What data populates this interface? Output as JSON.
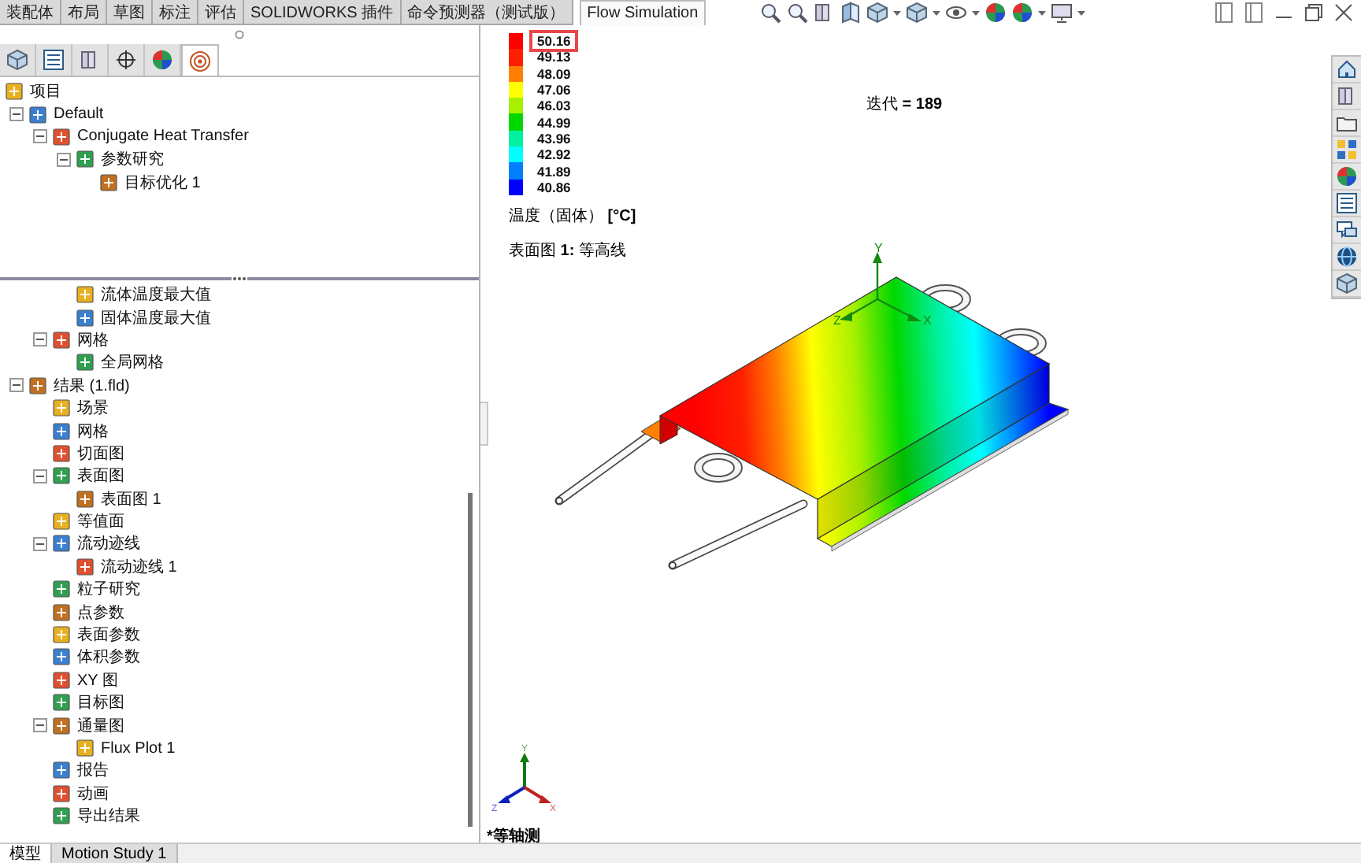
{
  "command_tabs": [
    {
      "label": "装配体",
      "selected": false
    },
    {
      "label": "布局",
      "selected": false
    },
    {
      "label": "草图",
      "selected": false
    },
    {
      "label": "标注",
      "selected": false
    },
    {
      "label": "评估",
      "selected": false
    },
    {
      "label": "SOLIDWORKS 插件",
      "selected": false
    },
    {
      "label": "命令预测器（测试版）",
      "selected": false
    },
    {
      "label": "Flow Simulation",
      "selected": true
    }
  ],
  "panel_tabs": [
    {
      "selected": false
    },
    {
      "selected": false
    },
    {
      "selected": false
    },
    {
      "selected": false
    },
    {
      "selected": false
    },
    {
      "selected": true
    }
  ],
  "upper_tree": [
    {
      "label": "项目",
      "children": [
        {
          "label": "Default",
          "expanded": true,
          "children": [
            {
              "label": "Conjugate Heat Transfer",
              "expanded": true,
              "children": [
                {
                  "label": "参数研究",
                  "expanded": true,
                  "children": [
                    {
                      "label": "目标优化 1"
                    }
                  ]
                }
              ]
            }
          ]
        }
      ]
    }
  ],
  "lower_tree": [
    {
      "children": [
        {
          "children": [
            {
              "children": [
                {
                  "label": "流体温度最大值"
                },
                {
                  "label": "固体温度最大值"
                }
              ]
            },
            {
              "label": "网格",
              "expanded": true,
              "children": [
                {
                  "label": "全局网格"
                }
              ]
            }
          ]
        },
        {
          "label": "结果 (1.fld)",
          "expanded": true,
          "children": [
            {
              "label": "场景"
            },
            {
              "label": "网格"
            },
            {
              "label": "切面图"
            },
            {
              "label": "表面图",
              "expanded": true,
              "children": [
                {
                  "label": "表面图 1"
                }
              ]
            },
            {
              "label": "等值面"
            },
            {
              "label": "流动迹线",
              "expanded": true,
              "children": [
                {
                  "label": "流动迹线 1"
                }
              ]
            },
            {
              "label": "粒子研究"
            },
            {
              "label": "点参数"
            },
            {
              "label": "表面参数"
            },
            {
              "label": "体积参数"
            },
            {
              "label": "XY 图"
            },
            {
              "label": "目标图"
            },
            {
              "label": "通量图",
              "expanded": true,
              "children": [
                {
                  "label": "Flux Plot 1"
                }
              ]
            },
            {
              "label": "报告"
            },
            {
              "label": "动画"
            },
            {
              "label": "导出结果"
            }
          ]
        }
      ]
    }
  ],
  "legend": {
    "entries": [
      {
        "value": "50.16",
        "color": "#ff0000",
        "highlighted": true
      },
      {
        "value": "49.13",
        "color": "#ff2000",
        "highlighted": false
      },
      {
        "value": "48.09",
        "color": "#ff8000",
        "highlighted": false
      },
      {
        "value": "47.06",
        "color": "#ffff00",
        "highlighted": false
      },
      {
        "value": "46.03",
        "color": "#a8f000",
        "highlighted": false
      },
      {
        "value": "44.99",
        "color": "#00d800",
        "highlighted": false
      },
      {
        "value": "43.96",
        "color": "#00f0a0",
        "highlighted": false
      },
      {
        "value": "42.92",
        "color": "#00ffff",
        "highlighted": false
      },
      {
        "value": "41.89",
        "color": "#0080ff",
        "highlighted": false
      },
      {
        "value": "40.86",
        "color": "#0000ff",
        "highlighted": false
      }
    ],
    "title": "温度（固体） **[°C]**"
  },
  "plot_caption": "表面图 **1:** 等高线",
  "iteration": "迭代 **= 189**",
  "model_axes": [
    "Y",
    "Z",
    "X"
  ],
  "triad_axes": [
    "Y",
    "Z",
    "X"
  ],
  "view_name": "*等轴测",
  "bottom_tabs": [
    {
      "label": "模型",
      "selected": true
    },
    {
      "label": "Motion Study 1",
      "selected": false
    }
  ]
}
